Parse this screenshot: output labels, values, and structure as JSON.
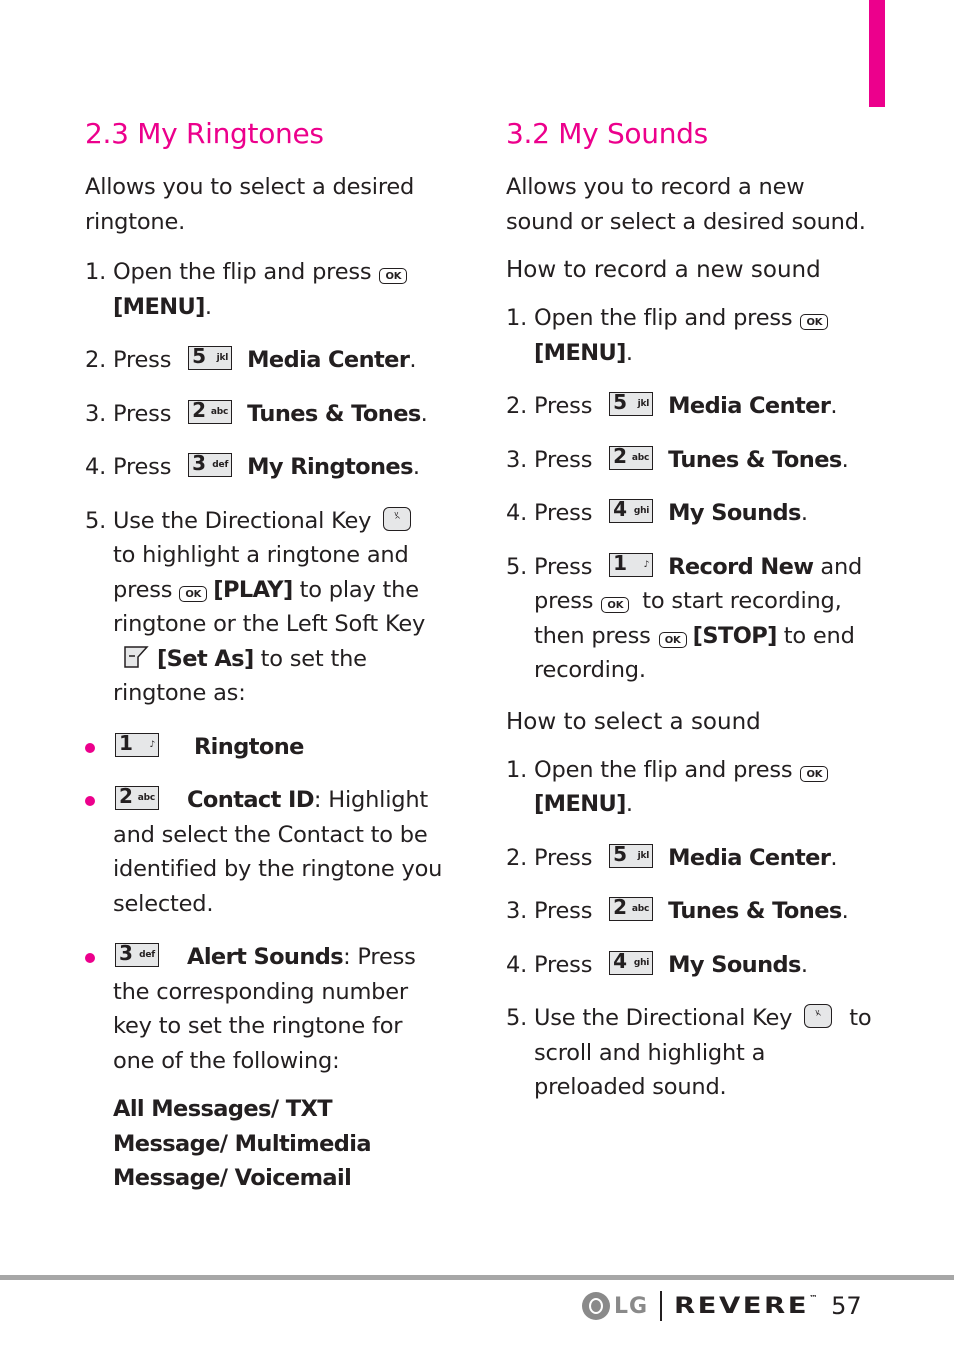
{
  "colors": {
    "accent": "#ec008c",
    "footer_rule": "#a7a7a7",
    "text": "#231f20"
  },
  "left": {
    "title": "2.3 My Ringtones",
    "intro": "Allows you to select a desired ringtone.",
    "steps": [
      {
        "num": "1.",
        "pre": "Open the flip and press",
        "icon": "ok-key",
        "bold": "[MENU]",
        "post": "."
      },
      {
        "num": "2.",
        "pre": "Press",
        "key_digit": "5",
        "key_letters": "jkl",
        "bold": "Media Center",
        "post": "."
      },
      {
        "num": "3.",
        "pre": "Press",
        "key_digit": "2",
        "key_letters": "abc",
        "bold": "Tunes & Tones",
        "post": "."
      },
      {
        "num": "4.",
        "pre": "Press",
        "key_digit": "3",
        "key_letters": "def",
        "bold": "My Ringtones",
        "post": "."
      },
      {
        "num": "5.",
        "a": "Use the Directional Key",
        "b": "to highlight a ringtone and press",
        "c": "[PLAY]",
        "d": "to play the ringtone or the Left Soft Key",
        "e": "[Set As]",
        "f": "to set the ringtone as:"
      }
    ],
    "bullets": [
      {
        "key_digit": "1",
        "key_letters": "voicemail",
        "bold": "Ringtone",
        "rest": ""
      },
      {
        "key_digit": "2",
        "key_letters": "abc",
        "bold": "Contact ID",
        "rest": ": Highlight and select the Contact to be identified by the ringtone you selected."
      },
      {
        "key_digit": "3",
        "key_letters": "def",
        "bold": "Alert Sounds",
        "rest": ": Press the corresponding number key to set the ringtone for one of the following:"
      }
    ],
    "sublist": "All Messages/ TXT Message/ Multimedia Message/ Voicemail"
  },
  "right": {
    "title": "3.2 My Sounds",
    "intro": "Allows you to record a new sound or select a desired sound.",
    "record_heading": "How to record a new sound",
    "record_steps": [
      {
        "num": "1.",
        "pre": "Open the flip and press",
        "bold": "[MENU]",
        "post": "."
      },
      {
        "num": "2.",
        "pre": "Press",
        "key_digit": "5",
        "key_letters": "jkl",
        "bold": "Media Center",
        "post": "."
      },
      {
        "num": "3.",
        "pre": "Press",
        "key_digit": "2",
        "key_letters": "abc",
        "bold": "Tunes & Tones",
        "post": "."
      },
      {
        "num": "4.",
        "pre": "Press",
        "key_digit": "4",
        "key_letters": "ghi",
        "bold": "My Sounds",
        "post": "."
      },
      {
        "num": "5.",
        "pre": "Press",
        "key_digit": "1",
        "bold": "Record New",
        "a": "and press",
        "b": "to start recording, then press",
        "c": "[STOP]",
        "d": "to end recording."
      }
    ],
    "select_heading": "How to select a sound",
    "select_steps": [
      {
        "num": "1.",
        "pre": "Open the flip and press",
        "bold": "[MENU]",
        "post": "."
      },
      {
        "num": "2.",
        "pre": "Press",
        "key_digit": "5",
        "key_letters": "jkl",
        "bold": "Media Center",
        "post": "."
      },
      {
        "num": "3.",
        "pre": "Press",
        "key_digit": "2",
        "key_letters": "abc",
        "bold": "Tunes & Tones",
        "post": "."
      },
      {
        "num": "4.",
        "pre": "Press",
        "key_digit": "4",
        "key_letters": "ghi",
        "bold": "My Sounds",
        "post": "."
      },
      {
        "num": "5.",
        "a": "Use the Directional Key",
        "b": "to scroll and highlight a preloaded sound."
      }
    ]
  },
  "footer": {
    "logo_text": "LG",
    "brand": "REVERE",
    "trademark": "™",
    "page_number": "57"
  },
  "icons": {
    "ok": "OK",
    "voicemail_glyph": "♪"
  }
}
